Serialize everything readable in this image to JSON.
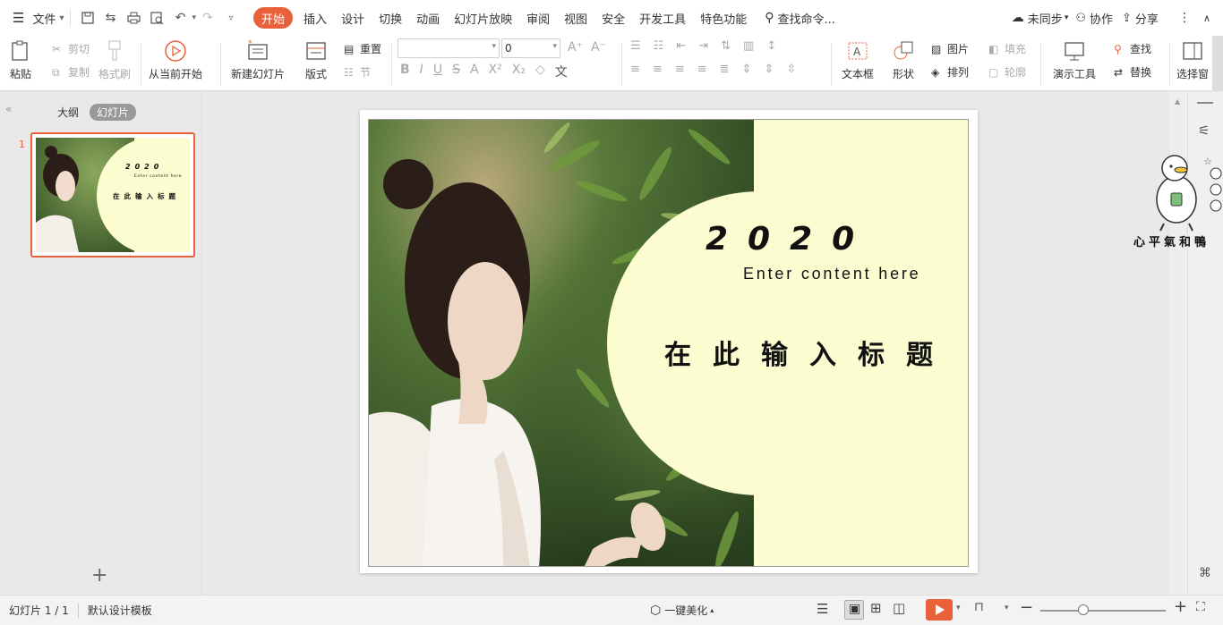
{
  "menubar": {
    "file_label": "文件",
    "tabs": [
      "开始",
      "插入",
      "设计",
      "切换",
      "动画",
      "幻灯片放映",
      "审阅",
      "视图",
      "安全",
      "开发工具",
      "特色功能"
    ],
    "active_tab": "开始",
    "search_label": "查找命令...",
    "sync_label": "未同步",
    "collab_label": "协作",
    "share_label": "分享"
  },
  "ribbon": {
    "paste": "粘贴",
    "cut": "剪切",
    "copy": "复制",
    "format_painter": "格式刷",
    "start_from_current": "从当前开始",
    "new_slide": "新建幻灯片",
    "layout": "版式",
    "reset": "重置",
    "section": "节",
    "font_size_value": "0",
    "text_box": "文本框",
    "shapes": "形状",
    "picture": "图片",
    "fill": "填充",
    "arrange": "排列",
    "outline": "轮廓",
    "presentation_tools": "演示工具",
    "find": "查找",
    "replace": "替换",
    "select_pane": "选择窗"
  },
  "left_panel": {
    "tab_outline": "大纲",
    "tab_slides": "幻灯片",
    "slide_number": "1",
    "thumb_year": "2020",
    "thumb_subtitle": "Enter content here",
    "thumb_title": "在此输入标题"
  },
  "slide": {
    "year": "2020",
    "subtitle": "Enter content here",
    "title": "在此输入标题"
  },
  "mascot_caption": "心平氣和鴨",
  "statusbar": {
    "slide_counter": "幻灯片 1 / 1",
    "template": "默认设计模板",
    "beautify": "一键美化"
  },
  "colors": {
    "accent": "#e8613a",
    "slide_bg": "#fbfcd0",
    "foliage": "#3e5a2a"
  }
}
